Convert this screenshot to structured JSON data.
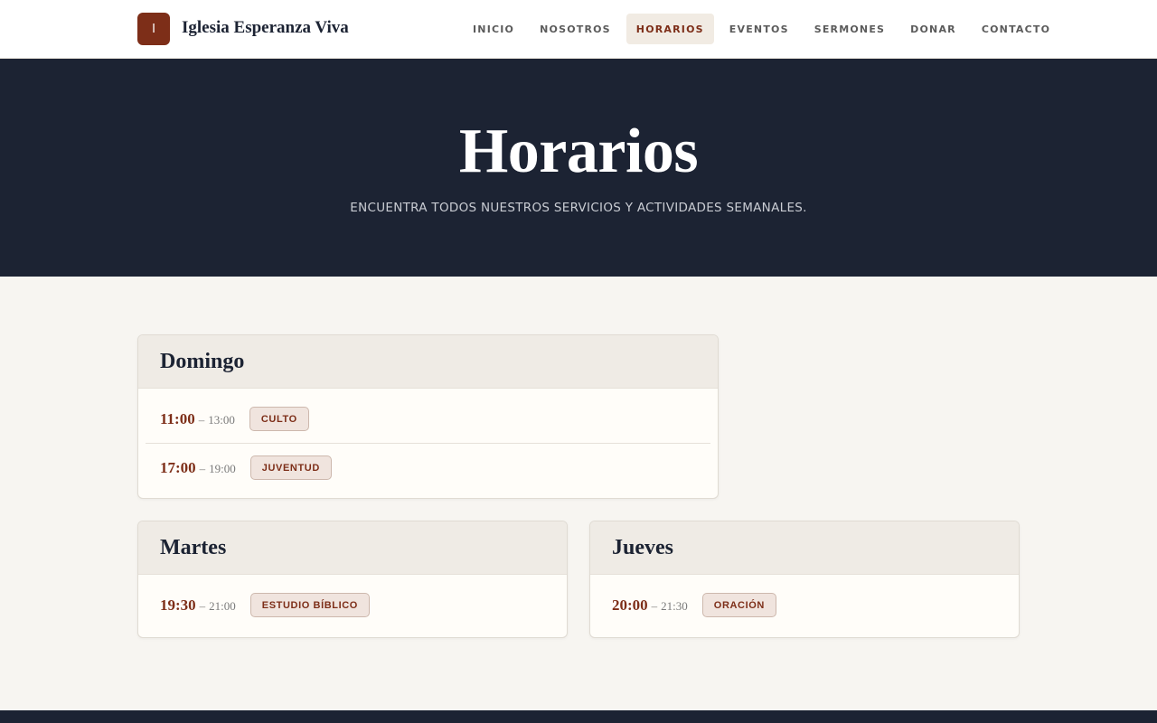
{
  "header": {
    "logo_letter": "I",
    "brand": "Iglesia Esperanza Viva",
    "nav": [
      "INICIO",
      "NOSOTROS",
      "HORARIOS",
      "EVENTOS",
      "SERMONES",
      "DONAR",
      "CONTACTO"
    ],
    "active_nav": "HORARIOS"
  },
  "hero": {
    "title": "Horarios",
    "subtitle": "ENCUENTRA TODOS NUESTROS SERVICIOS Y ACTIVIDADES SEMANALES."
  },
  "schedule": [
    {
      "day": "Domingo",
      "items": [
        {
          "start": "11:00",
          "end": "13:00",
          "label": "CULTO"
        },
        {
          "start": "17:00",
          "end": "19:00",
          "label": "JUVENTUD"
        }
      ]
    },
    {
      "day": "Martes",
      "items": [
        {
          "start": "19:30",
          "end": "21:00",
          "label": "ESTUDIO BÍBLICO"
        }
      ]
    },
    {
      "day": "Jueves",
      "items": [
        {
          "start": "20:00",
          "end": "21:30",
          "label": "ORACIÓN"
        }
      ]
    }
  ],
  "colors": {
    "brand": "#7d2e18",
    "navy": "#1c2333",
    "background": "#f7f5f1"
  }
}
